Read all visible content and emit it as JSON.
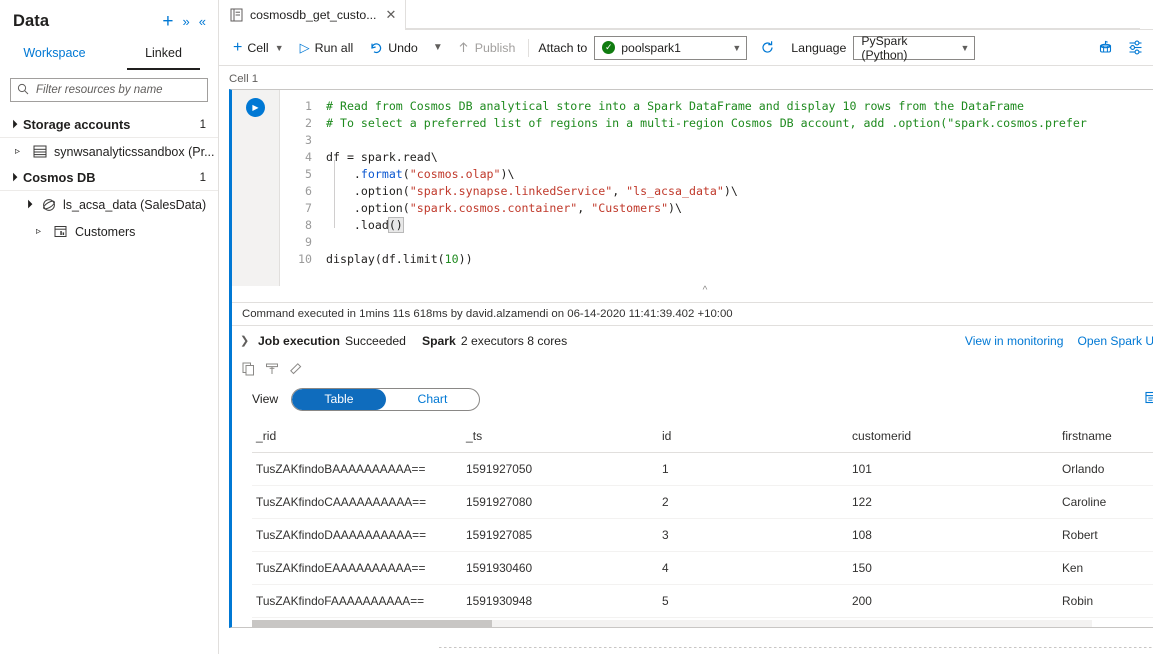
{
  "sidebar": {
    "title": "Data",
    "actions": [
      {
        "name": "add-icon",
        "glyph": "+"
      },
      {
        "name": "more-actions-chevron-icon",
        "glyph": "»"
      },
      {
        "name": "collapse-panel-icon",
        "glyph": "«"
      }
    ],
    "tabs": [
      {
        "label": "Workspace",
        "active": false
      },
      {
        "label": "Linked",
        "active": true
      }
    ],
    "filter_placeholder": "Filter resources by name",
    "filter_value": "",
    "groups": [
      {
        "label": "Storage accounts",
        "count": "1",
        "items": [
          {
            "label": "synwsanalyticssandbox (Pr...",
            "level": 1,
            "expander": "right",
            "icon": "storage-account-icon"
          }
        ]
      },
      {
        "label": "Cosmos DB",
        "count": "1",
        "items": [
          {
            "label": "ls_acsa_data (SalesData)",
            "level": 2,
            "expander": "down",
            "icon": "cosmos-db-icon"
          },
          {
            "label": "Customers",
            "level": 3,
            "expander": "right",
            "icon": "container-icon"
          }
        ]
      }
    ]
  },
  "tabstrip": {
    "doc_tab_label": "cosmosdb_get_custo...",
    "doc_tab_close": "✕",
    "more_glyph": "···"
  },
  "toolbar": {
    "cell_label": "Cell",
    "run_all_label": "Run all",
    "undo_label": "Undo",
    "publish_label": "Publish",
    "attach_to_label": "Attach to",
    "pool_value": "poolspark1",
    "language_label": "Language",
    "language_value": "PySpark (Python)",
    "right_icons": [
      {
        "name": "view-spark-monitoring-icon"
      },
      {
        "name": "notebook-settings-icon"
      },
      {
        "name": "more-commands-icon",
        "glyph": "···"
      }
    ]
  },
  "notebook": {
    "cell_caption": "Cell 1",
    "code_lines": [
      {
        "n": "1",
        "tokens": [
          {
            "t": "# Read from Cosmos DB analytical store into a Spark DataFrame and display 10 rows from the DataFrame",
            "c": "tk-com"
          }
        ]
      },
      {
        "n": "2",
        "tokens": [
          {
            "t": "# To select a preferred list of regions in a multi-region Cosmos DB account, add .option(\"spark.cosmos.prefer",
            "c": "tk-com"
          }
        ]
      },
      {
        "n": "3",
        "tokens": []
      },
      {
        "n": "4",
        "tokens": [
          {
            "t": "df = spark.read\\",
            "c": "tk-def"
          }
        ]
      },
      {
        "n": "5",
        "tokens": [
          {
            "t": "    .",
            "c": "tk-def"
          },
          {
            "t": "format",
            "c": "tk-fn"
          },
          {
            "t": "(",
            "c": "tk-def"
          },
          {
            "t": "\"cosmos.olap\"",
            "c": "tk-str"
          },
          {
            "t": ")\\",
            "c": "tk-def"
          }
        ]
      },
      {
        "n": "6",
        "tokens": [
          {
            "t": "    .option(",
            "c": "tk-def"
          },
          {
            "t": "\"spark.synapse.linkedService\"",
            "c": "tk-str"
          },
          {
            "t": ", ",
            "c": "tk-def"
          },
          {
            "t": "\"ls_acsa_data\"",
            "c": "tk-str"
          },
          {
            "t": ")\\",
            "c": "tk-def"
          }
        ]
      },
      {
        "n": "7",
        "tokens": [
          {
            "t": "    .option(",
            "c": "tk-def"
          },
          {
            "t": "\"spark.cosmos.container\"",
            "c": "tk-str"
          },
          {
            "t": ", ",
            "c": "tk-def"
          },
          {
            "t": "\"Customers\"",
            "c": "tk-str"
          },
          {
            "t": ")\\",
            "c": "tk-def"
          }
        ]
      },
      {
        "n": "8",
        "tokens": [
          {
            "t": "    .load",
            "c": "tk-def"
          },
          {
            "t": "()",
            "c": "tk-def bracket-hl"
          }
        ]
      },
      {
        "n": "9",
        "tokens": []
      },
      {
        "n": "10",
        "tokens": [
          {
            "t": "display(df.limit(",
            "c": "tk-def"
          },
          {
            "t": "10",
            "c": "tk-num"
          },
          {
            "t": "))",
            "c": "tk-def"
          }
        ]
      }
    ],
    "execution_text": "Command executed in 1mins 11s 618ms by david.alzamendi on 06-14-2020 11:41:39.402 +10:00",
    "job_execution_label": "Job execution",
    "job_execution_status": "Succeeded",
    "spark_label": "Spark",
    "spark_detail": "2 executors 8 cores",
    "view_in_monitoring": "View in monitoring",
    "open_spark_ui": "Open Spark UI",
    "open_spark_ui_glyph": "⧉",
    "output_tools": [
      {
        "name": "copy-output-icon"
      },
      {
        "name": "filter-output-icon"
      },
      {
        "name": "clear-output-icon"
      }
    ],
    "view_label": "View",
    "view_options": [
      {
        "label": "Table",
        "active": true
      },
      {
        "label": "Chart",
        "active": false
      }
    ],
    "export_icon_name": "export-results-icon"
  },
  "results": {
    "columns": [
      "_rid",
      "_ts",
      "id",
      "customerid",
      "firstname"
    ],
    "rows": [
      [
        "TusZAKfindoBAAAAAAAAAA==",
        "1591927050",
        "1",
        "101",
        "Orlando"
      ],
      [
        "TusZAKfindoCAAAAAAAAAA==",
        "1591927080",
        "2",
        "122",
        "Caroline"
      ],
      [
        "TusZAKfindoDAAAAAAAAAA==",
        "1591927085",
        "3",
        "108",
        "Robert"
      ],
      [
        "TusZAKfindoEAAAAAAAAAA==",
        "1591930460",
        "4",
        "150",
        "Ken"
      ],
      [
        "TusZAKfindoFAAAAAAAAAA==",
        "1591930948",
        "5",
        "200",
        "Robin"
      ]
    ]
  },
  "colors": {
    "accent": "#0078d4",
    "pill_active": "#0f6cbd",
    "success": "#107c10",
    "comment_green": "#1e8a1e",
    "string_red": "#c0392b"
  }
}
